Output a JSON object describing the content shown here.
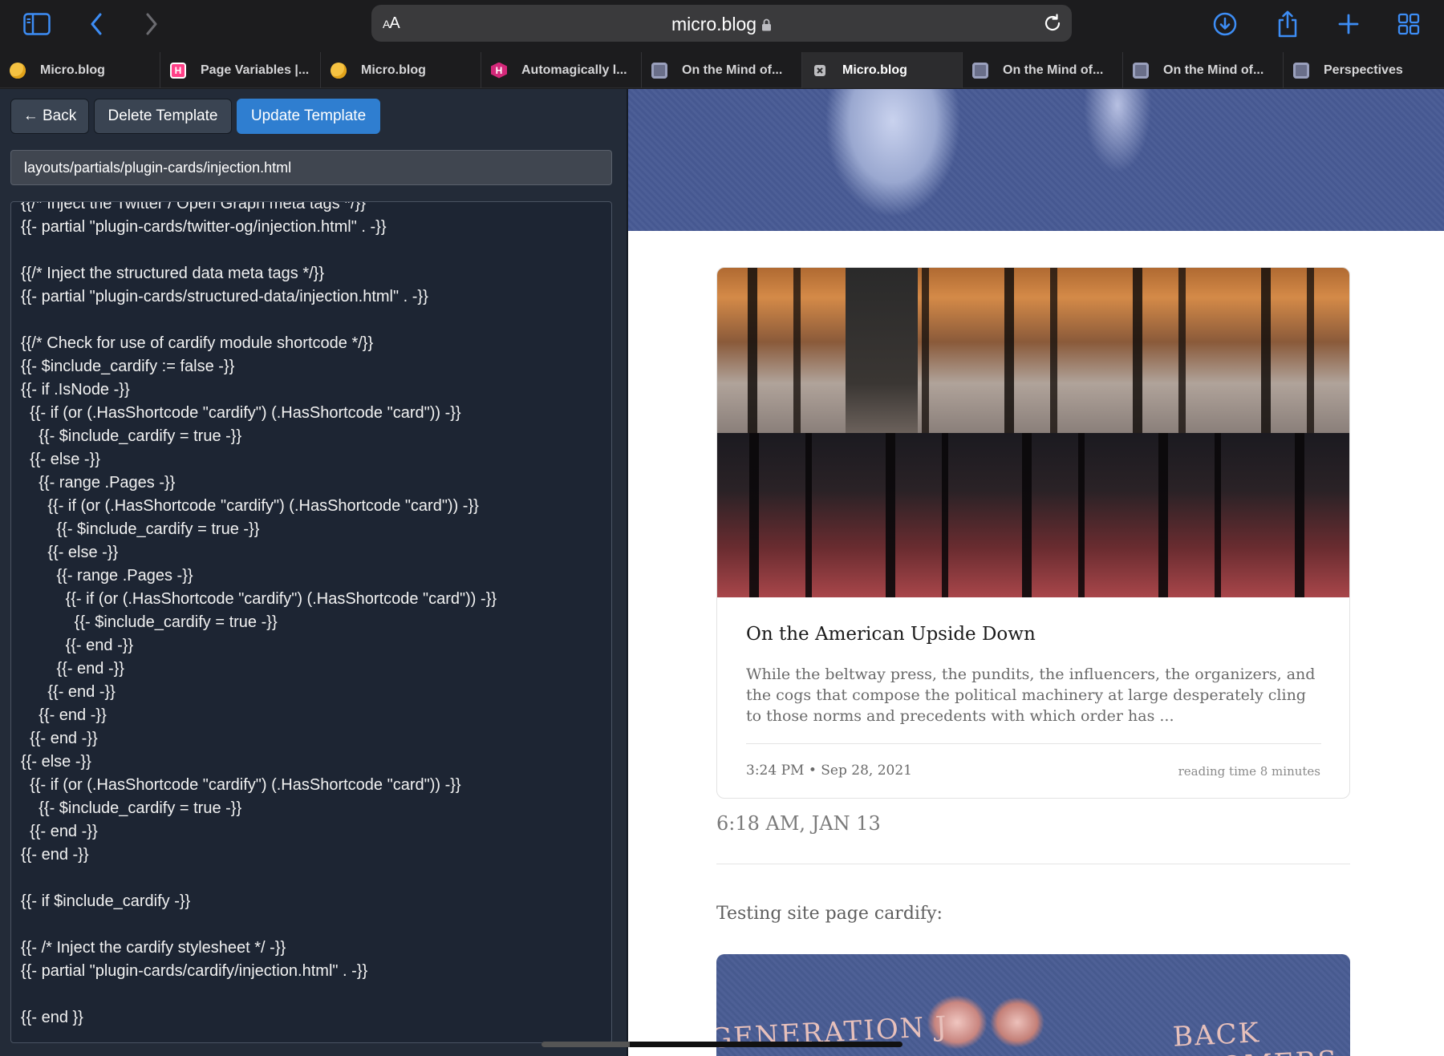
{
  "browser": {
    "url_text": "micro.blog",
    "aa_label": "AA",
    "aa_small": "A",
    "toolbar_icons": [
      "sidebar-icon",
      "back-arrow-icon",
      "forward-arrow-icon",
      "lock-icon",
      "reload-icon",
      "download-icon",
      "share-icon",
      "new-tab-icon",
      "tab-overview-icon"
    ]
  },
  "tabs": [
    {
      "label": "Micro.blog",
      "favicon": "micro-blog-icon",
      "active": false
    },
    {
      "label": "Page Variables |...",
      "favicon": "hugo-icon",
      "active": false
    },
    {
      "label": "Micro.blog",
      "favicon": "micro-blog-icon",
      "active": false
    },
    {
      "label": "Automagically l...",
      "favicon": "hugo-icon",
      "active": false
    },
    {
      "label": "On the Mind of...",
      "favicon": "blog-favicon-icon",
      "active": false
    },
    {
      "label": "Micro.blog",
      "favicon": "close-icon",
      "active": true
    },
    {
      "label": "On the Mind of...",
      "favicon": "blog-favicon-icon",
      "active": false
    },
    {
      "label": "On the Mind of...",
      "favicon": "blog-favicon-icon",
      "active": false
    },
    {
      "label": "Perspectives",
      "favicon": "blog-favicon-icon",
      "active": false
    }
  ],
  "editor": {
    "back_label": "← Back",
    "delete_label": "Delete Template",
    "update_label": "Update Template",
    "path_value": "layouts/partials/plugin-cards/injection.html",
    "code_lines": [
      "{{/* Inject the Twitter / Open Graph meta tags */}}",
      "{{- partial \"plugin-cards/twitter-og/injection.html\" . -}}",
      "",
      "{{/* Inject the structured data meta tags */}}",
      "{{- partial \"plugin-cards/structured-data/injection.html\" . -}}",
      "",
      "{{/* Check for use of cardify module shortcode */}}",
      "{{- $include_cardify := false -}}",
      "{{- if .IsNode -}}",
      "  {{- if (or (.HasShortcode \"cardify\") (.HasShortcode \"card\")) -}}",
      "    {{- $include_cardify = true -}}",
      "  {{- else -}}",
      "    {{- range .Pages -}}",
      "      {{- if (or (.HasShortcode \"cardify\") (.HasShortcode \"card\")) -}}",
      "        {{- $include_cardify = true -}}",
      "      {{- else -}}",
      "        {{- range .Pages -}}",
      "          {{- if (or (.HasShortcode \"cardify\") (.HasShortcode \"card\")) -}}",
      "            {{- $include_cardify = true -}}",
      "          {{- end -}}",
      "        {{- end -}}",
      "      {{- end -}}",
      "    {{- end -}}",
      "  {{- end -}}",
      "{{- else -}}",
      "  {{- if (or (.HasShortcode \"cardify\") (.HasShortcode \"card\")) -}}",
      "    {{- $include_cardify = true -}}",
      "  {{- end -}}",
      "{{- end -}}",
      "",
      "{{- if $include_cardify -}}",
      "",
      "{{- /* Inject the cardify stylesheet */ -}}",
      "{{- partial \"plugin-cards/cardify/injection.html\" . -}}",
      "",
      "{{- end }}"
    ]
  },
  "preview": {
    "card": {
      "title": "On the American Upside Down",
      "excerpt": "While the beltway press, the pundits, the influencers, the organizers, and the cogs that compose the political machinery at large desperately cling to those norms and precedents with which order has ...",
      "date": "3:24 PM • Sep 28, 2021",
      "reading_time": "reading time 8 minutes"
    },
    "post_time": "6:18 AM, JAN 13",
    "post_text": "Testing site page cardify:",
    "card2_words": [
      "GENERATION J",
      "BACK BOOMERS"
    ]
  }
}
